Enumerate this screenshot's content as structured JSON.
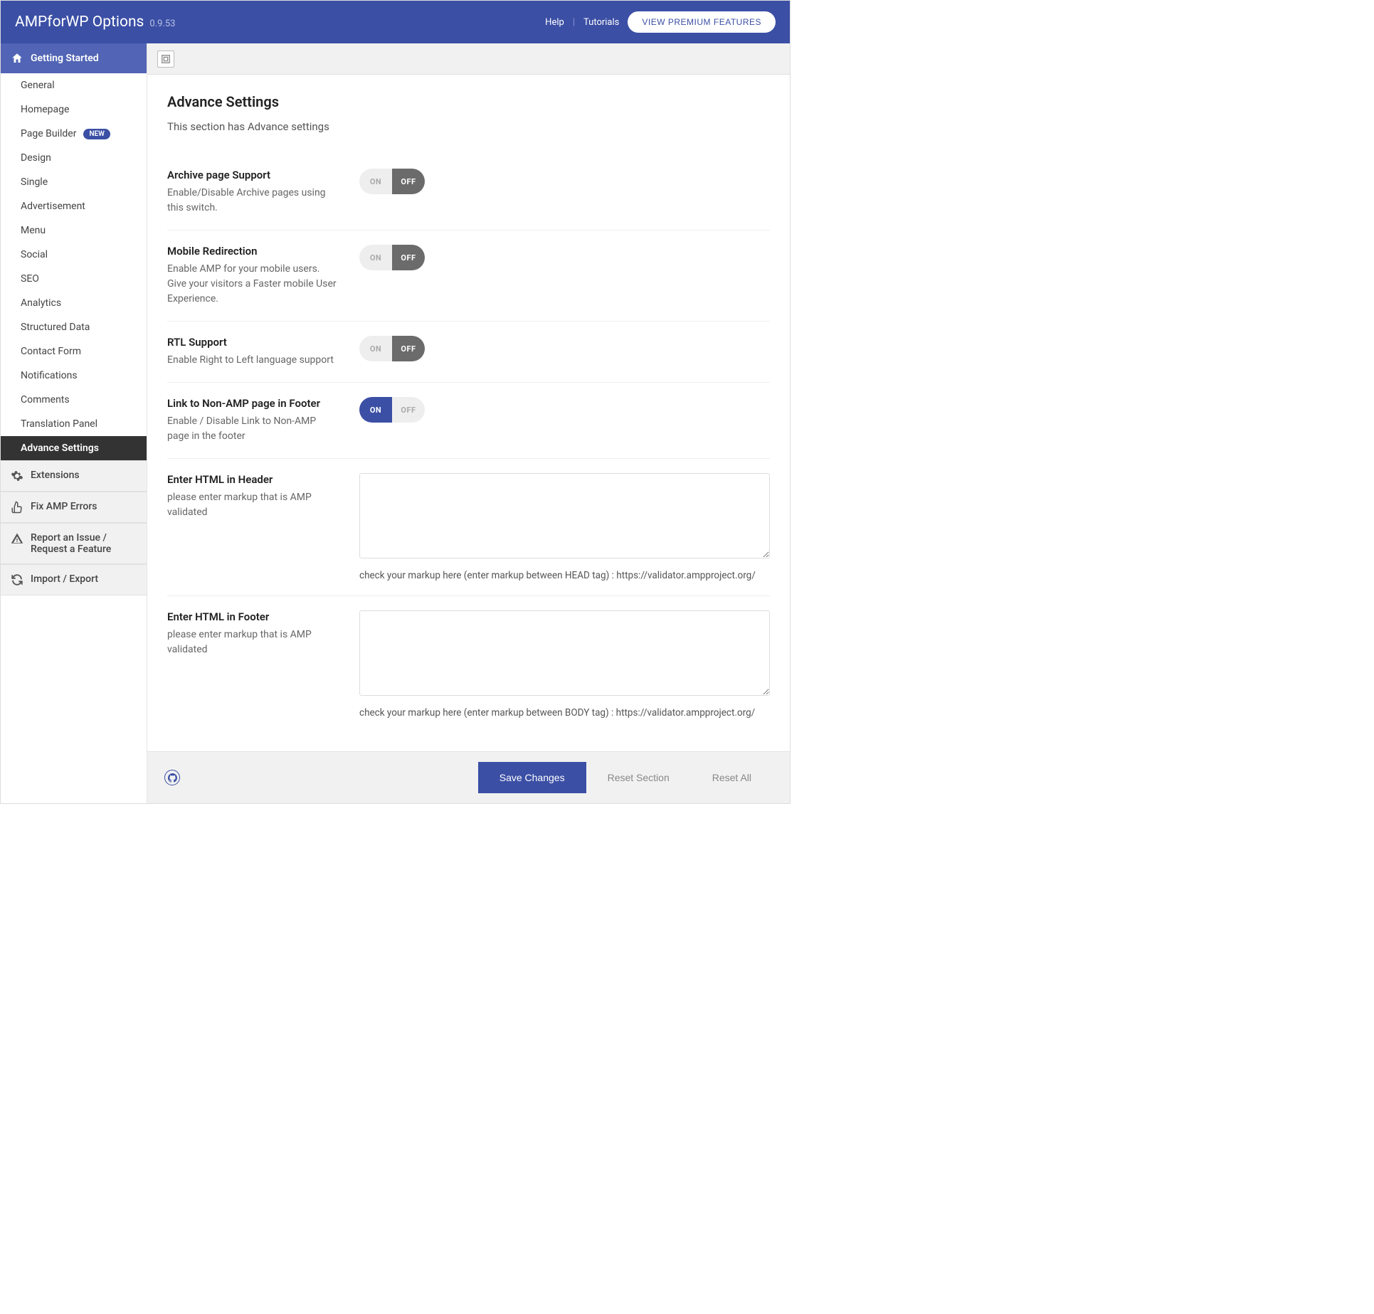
{
  "header": {
    "title": "AMPforWP Options",
    "version": "0.9.53",
    "help": "Help",
    "tutorials": "Tutorials",
    "premium_btn": "VIEW PREMIUM FEATURES"
  },
  "sidebar": {
    "top": "Getting Started",
    "items": [
      "General",
      "Homepage",
      "Page Builder",
      "Design",
      "Single",
      "Advertisement",
      "Menu",
      "Social",
      "SEO",
      "Analytics",
      "Structured Data",
      "Contact Form",
      "Notifications",
      "Comments",
      "Translation Panel",
      "Advance Settings"
    ],
    "new_badge": "NEW",
    "extensions": "Extensions",
    "fix_errors": "Fix AMP Errors",
    "report_issue": "Report an Issue / Request a Feature",
    "import_export": "Import / Export"
  },
  "page": {
    "title": "Advance Settings",
    "desc": "This section has Advance settings"
  },
  "fields": {
    "archive": {
      "label": "Archive page Support",
      "help": "Enable/Disable Archive pages using this switch."
    },
    "mobile": {
      "label": "Mobile Redirection",
      "help": "Enable AMP for your mobile users. Give your visitors a Faster mobile User Experience."
    },
    "rtl": {
      "label": "RTL Support",
      "help": "Enable Right to Left language support"
    },
    "nonamp": {
      "label": "Link to Non-AMP page in Footer",
      "help": "Enable / Disable Link to Non-AMP page in the footer"
    },
    "html_header": {
      "label": "Enter HTML in Header",
      "help": "please enter markup that is AMP validated",
      "hint": "check your markup here (enter markup between HEAD tag) : https://validator.ampproject.org/"
    },
    "html_footer": {
      "label": "Enter HTML in Footer",
      "help": "please enter markup that is AMP validated",
      "hint": "check your markup here (enter markup between BODY tag) : https://validator.ampproject.org/"
    }
  },
  "toggle": {
    "on": "ON",
    "off": "OFF"
  },
  "footer": {
    "save": "Save Changes",
    "reset_section": "Reset Section",
    "reset_all": "Reset All"
  }
}
